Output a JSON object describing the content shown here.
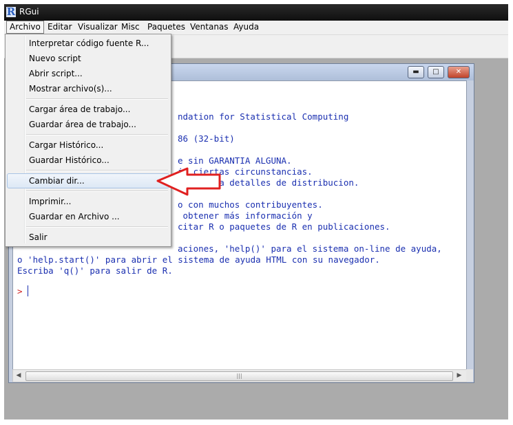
{
  "window": {
    "title": "RGui",
    "icon": "r-logo-icon"
  },
  "menubar": [
    "Archivo",
    "Editar",
    "Visualizar",
    "Misc",
    "Paquetes",
    "Ventanas",
    "Ayuda"
  ],
  "file_menu": {
    "items": [
      "Interpretar código fuente R...",
      "Nuevo script",
      "Abrir script...",
      "Mostrar archivo(s)...",
      "Cargar área de trabajo...",
      "Guardar  área de trabajo...",
      "Cargar Histórico...",
      "Guardar Histórico...",
      "Cambiar dir...",
      "Imprimir...",
      "Guardar en Archivo ...",
      "Salir"
    ],
    "highlighted": "Cambiar dir..."
  },
  "console": {
    "visible_lines": [
      "ndation for Statistical Computing",
      "86 (32-bit)",
      "e sin GARANTIA ALGUNA.",
      "jo ciertas circunstancias.",
      "e()' para detalles de distribucion.",
      "o con muchos contribuyentes.",
      " obtener más información y",
      "citar R o paquetes de R en publicaciones.",
      "aciones, 'help()' para el sistema on-line de ayuda,",
      "o 'help.start()' para abrir el sistema de ayuda HTML con su navegador.",
      "Escriba 'q()' para salir de R."
    ],
    "prompt": ">",
    "text_color": "#1a2fb0",
    "prompt_color": "#d02020"
  },
  "annotation": {
    "color": "#e02020",
    "icon": "red-arrow-annotation"
  }
}
